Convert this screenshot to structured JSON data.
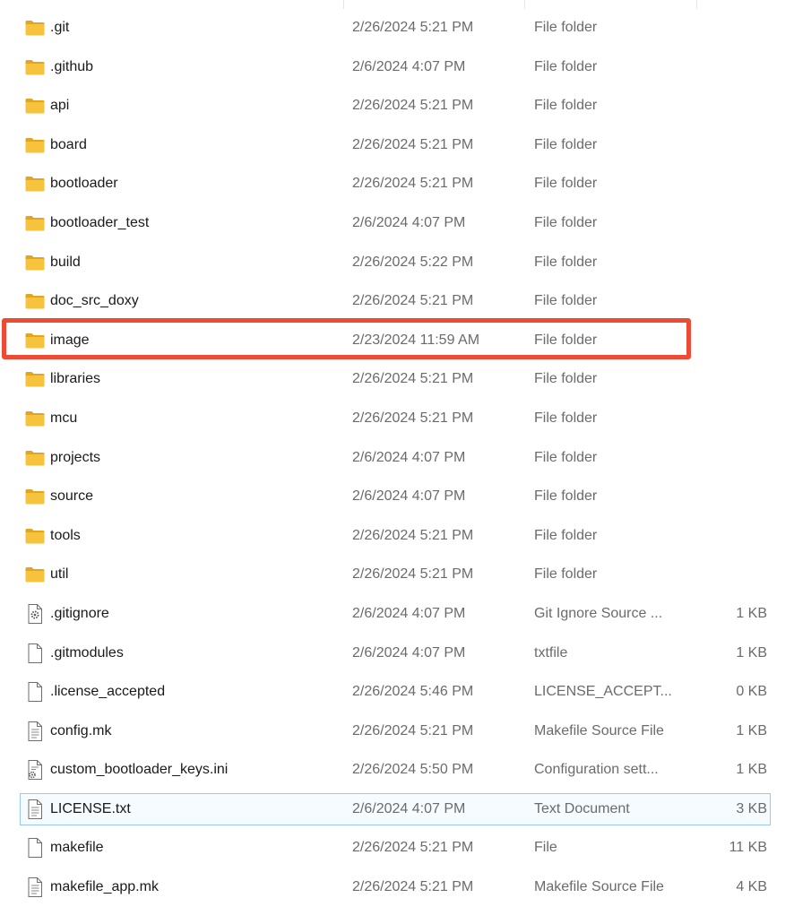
{
  "files": [
    {
      "name": ".git",
      "date": "2/26/2024 5:21 PM",
      "type": "File folder",
      "size": "",
      "icon": "folder-icon"
    },
    {
      "name": ".github",
      "date": "2/6/2024 4:07 PM",
      "type": "File folder",
      "size": "",
      "icon": "folder-icon"
    },
    {
      "name": "api",
      "date": "2/26/2024 5:21 PM",
      "type": "File folder",
      "size": "",
      "icon": "folder-icon"
    },
    {
      "name": "board",
      "date": "2/26/2024 5:21 PM",
      "type": "File folder",
      "size": "",
      "icon": "folder-icon"
    },
    {
      "name": "bootloader",
      "date": "2/26/2024 5:21 PM",
      "type": "File folder",
      "size": "",
      "icon": "folder-icon"
    },
    {
      "name": "bootloader_test",
      "date": "2/6/2024 4:07 PM",
      "type": "File folder",
      "size": "",
      "icon": "folder-icon"
    },
    {
      "name": "build",
      "date": "2/26/2024 5:22 PM",
      "type": "File folder",
      "size": "",
      "icon": "folder-icon"
    },
    {
      "name": "doc_src_doxy",
      "date": "2/26/2024 5:21 PM",
      "type": "File folder",
      "size": "",
      "icon": "folder-icon"
    },
    {
      "name": "image",
      "date": "2/23/2024 11:59 AM",
      "type": "File folder",
      "size": "",
      "icon": "folder-icon"
    },
    {
      "name": "libraries",
      "date": "2/26/2024 5:21 PM",
      "type": "File folder",
      "size": "",
      "icon": "folder-icon"
    },
    {
      "name": "mcu",
      "date": "2/26/2024 5:21 PM",
      "type": "File folder",
      "size": "",
      "icon": "folder-icon"
    },
    {
      "name": "projects",
      "date": "2/6/2024 4:07 PM",
      "type": "File folder",
      "size": "",
      "icon": "folder-icon"
    },
    {
      "name": "source",
      "date": "2/6/2024 4:07 PM",
      "type": "File folder",
      "size": "",
      "icon": "folder-icon"
    },
    {
      "name": "tools",
      "date": "2/26/2024 5:21 PM",
      "type": "File folder",
      "size": "",
      "icon": "folder-icon"
    },
    {
      "name": "util",
      "date": "2/26/2024 5:21 PM",
      "type": "File folder",
      "size": "",
      "icon": "folder-icon"
    },
    {
      "name": ".gitignore",
      "date": "2/6/2024 4:07 PM",
      "type": "Git Ignore Source ...",
      "size": "1 KB",
      "icon": "settings-file-icon"
    },
    {
      "name": ".gitmodules",
      "date": "2/6/2024 4:07 PM",
      "type": "txtfile",
      "size": "1 KB",
      "icon": "blank-file-icon"
    },
    {
      "name": ".license_accepted",
      "date": "2/26/2024 5:46 PM",
      "type": "LICENSE_ACCEPT...",
      "size": "0 KB",
      "icon": "blank-file-icon"
    },
    {
      "name": "config.mk",
      "date": "2/26/2024 5:21 PM",
      "type": "Makefile Source File",
      "size": "1 KB",
      "icon": "text-file-icon"
    },
    {
      "name": "custom_bootloader_keys.ini",
      "date": "2/26/2024 5:50 PM",
      "type": "Configuration sett...",
      "size": "1 KB",
      "icon": "config-file-icon"
    },
    {
      "name": "LICENSE.txt",
      "date": "2/6/2024 4:07 PM",
      "type": "Text Document",
      "size": "3 KB",
      "icon": "text-file-icon",
      "selected": true
    },
    {
      "name": "makefile",
      "date": "2/26/2024 5:21 PM",
      "type": "File",
      "size": "11 KB",
      "icon": "blank-file-icon"
    },
    {
      "name": "makefile_app.mk",
      "date": "2/26/2024 5:21 PM",
      "type": "Makefile Source File",
      "size": "4 KB",
      "icon": "text-file-icon"
    }
  ],
  "annotation": {
    "highlighted_item": "image",
    "color": "#ee4b35"
  },
  "colors": {
    "folder": "#f8c33c",
    "folder_dark": "#e2a520",
    "selection_border": "#99c9ef",
    "secondary_text": "#6b6b6b"
  }
}
